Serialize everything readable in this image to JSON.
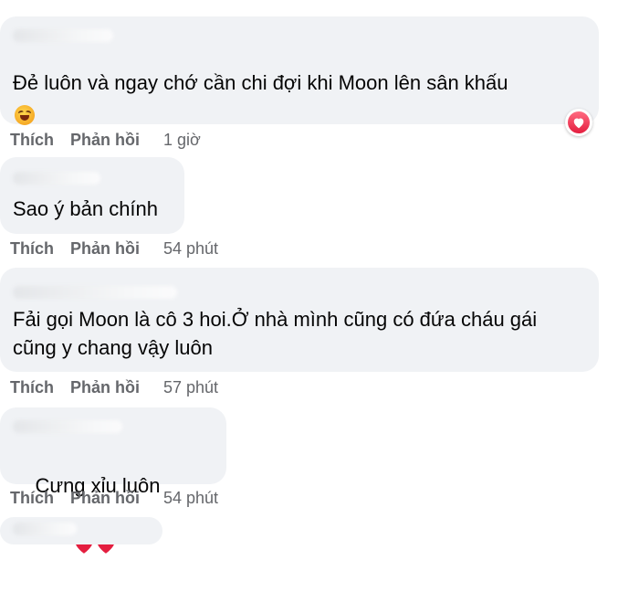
{
  "comments": [
    {
      "text": "Đẻ luôn và ngay chớ cần chi đợi khi Moon lên sân khấu",
      "like": "Thích",
      "reply": "Phản hồi",
      "time": "1 giờ",
      "reaction_icon": "heart-reaction-icon",
      "trailing_emoji": "laughing-emoji-icon"
    },
    {
      "text": "Sao ý bản chính",
      "like": "Thích",
      "reply": "Phản hồi",
      "time": "54 phút"
    },
    {
      "text": "Fải gọi Moon là cô 3 hoi.Ở nhà mình cũng có đứa cháu gái cũng y chang vậy luôn",
      "like": "Thích",
      "reply": "Phản hồi",
      "time": "57 phút"
    },
    {
      "text": "Cưng xỉu luôn",
      "like": "Thích",
      "reply": "Phản hồi",
      "time": "54 phút",
      "trailing_emoji": "two-red-hearts-icon"
    }
  ],
  "colors": {
    "bubble": "#f0f2f5",
    "meta_text": "#65676b",
    "heart": "#e41e3f"
  }
}
